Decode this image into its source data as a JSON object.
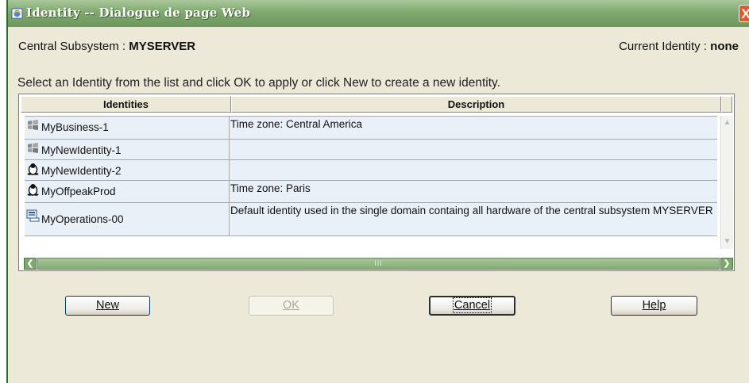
{
  "window": {
    "title": "Identity -- Dialogue de page Web",
    "close_glyph": "X"
  },
  "header": {
    "subsystem_label": "Central Subsystem : ",
    "subsystem_value": "MYSERVER",
    "identity_label": "Current Identity : ",
    "identity_value": "none"
  },
  "instruction": "Select an Identity from the list and click OK to apply or click New to create a new identity.",
  "grid": {
    "columns": [
      "Identities",
      "Description"
    ],
    "rows": [
      {
        "icon": "windows-icon",
        "name": "MyBusiness-1",
        "description": "Time zone: Central America"
      },
      {
        "icon": "windows-icon",
        "name": "MyNewIdentity-1",
        "description": ""
      },
      {
        "icon": "linux-icon",
        "name": "MyNewIdentity-2",
        "description": ""
      },
      {
        "icon": "linux-icon",
        "name": "MyOffpeakProd",
        "description": "Time zone: Paris"
      },
      {
        "icon": "server-icon",
        "name": "MyOperations-00",
        "description": "Default identity used in the single domain containg all hardware of the central subsystem MYSERVER"
      }
    ]
  },
  "buttons": {
    "new": "New",
    "ok": "OK",
    "cancel": "Cancel",
    "help": "Help"
  },
  "colors": {
    "titlebar": "#7fa86f",
    "dialog_bg": "#ece9d8",
    "row_bg": "#eaf0f7"
  }
}
